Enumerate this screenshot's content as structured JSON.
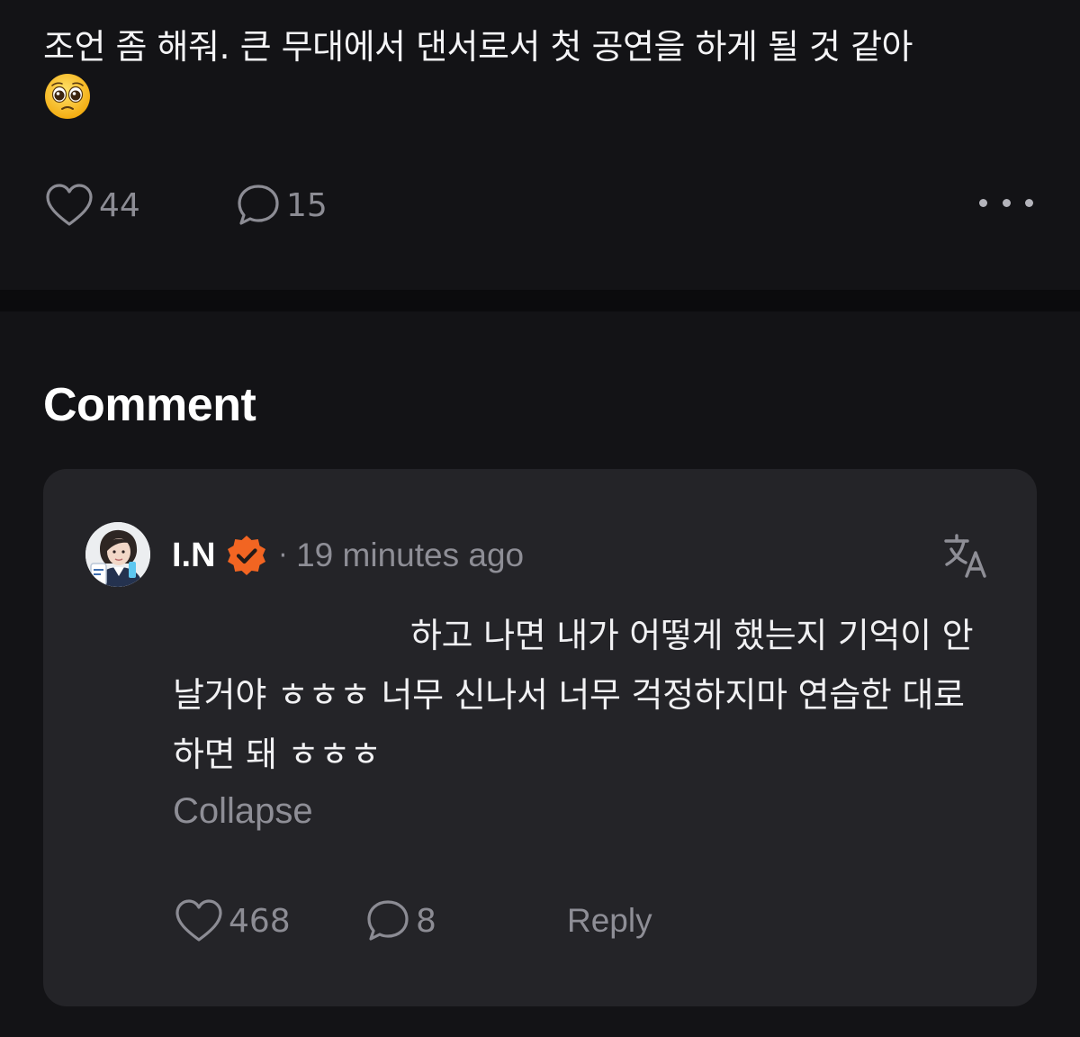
{
  "post": {
    "text": "조언 좀 해줘. 큰 무대에서 댄서로서 첫 공연을 하게 될 것 같아",
    "emoji": "pleading-face-emoji",
    "like_count": "44",
    "comment_count": "15"
  },
  "comments": {
    "section_title": "Comment",
    "item": {
      "author": "I.N",
      "separator": "·",
      "time": "19 minutes ago",
      "body": "하고 나면 내가 어떻게 했는지 기억이 안날거야 ㅎㅎㅎ 너무 신나서 너무 걱정하지마 연습한 대로 하면 돼 ㅎㅎㅎ",
      "collapse_label": "Collapse",
      "like_count": "468",
      "reply_count": "8",
      "reply_label": "Reply"
    }
  },
  "colors": {
    "background": "#131316",
    "divider": "#0b0b0d",
    "card": "#242428",
    "muted_text": "#8e8e96",
    "verified_badge": "#f26522"
  },
  "icons": [
    "heart-icon",
    "comment-bubble-icon",
    "more-dots-icon",
    "verified-badge-icon",
    "translate-icon"
  ]
}
